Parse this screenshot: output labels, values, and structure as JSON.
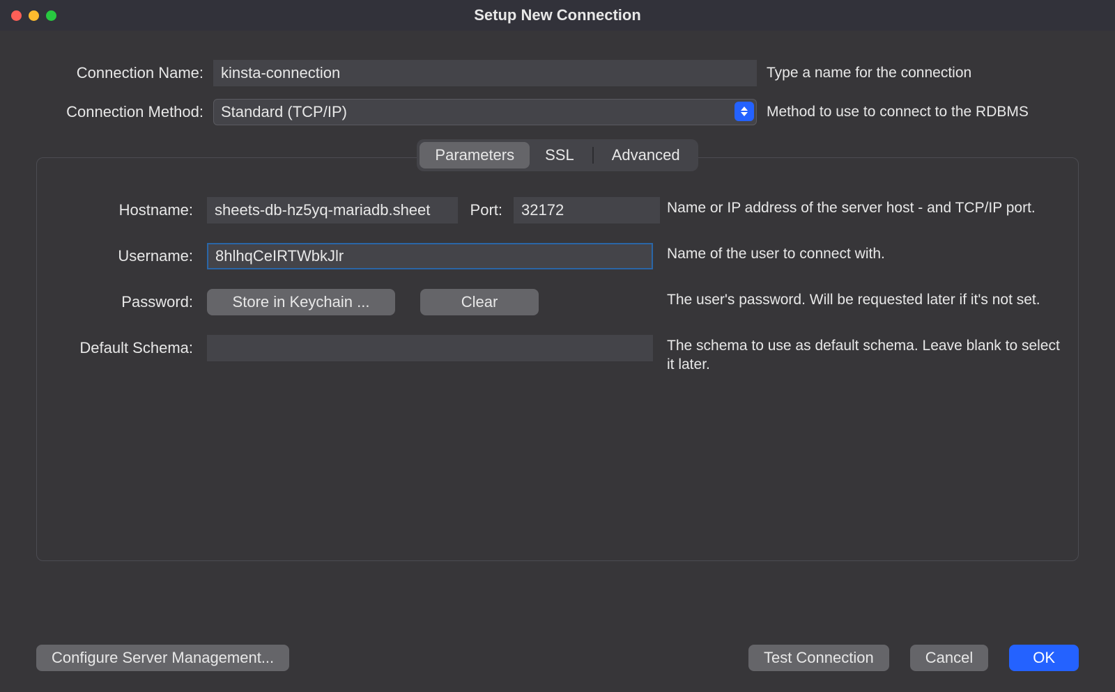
{
  "window": {
    "title": "Setup New Connection"
  },
  "top": {
    "name_label": "Connection Name:",
    "name_value": "kinsta-connection",
    "name_help": "Type a name for the connection",
    "method_label": "Connection Method:",
    "method_value": "Standard (TCP/IP)",
    "method_help": "Method to use to connect to the RDBMS"
  },
  "tabs": {
    "parameters": "Parameters",
    "ssl": "SSL",
    "advanced": "Advanced"
  },
  "params": {
    "hostname_label": "Hostname:",
    "hostname_value": "sheets-db-hz5yq-mariadb.sheet",
    "port_label": "Port:",
    "port_value": "32172",
    "hostport_help": "Name or IP address of the server host - and TCP/IP port.",
    "username_label": "Username:",
    "username_value": "8hlhqCeIRTWbkJlr",
    "username_help": "Name of the user to connect with.",
    "password_label": "Password:",
    "store_keychain": "Store in Keychain ...",
    "clear": "Clear",
    "password_help": "The user's password. Will be requested later if it's not set.",
    "schema_label": "Default Schema:",
    "schema_value": "",
    "schema_help": "The schema to use as default schema. Leave blank to select it later."
  },
  "footer": {
    "configure": "Configure Server Management...",
    "test": "Test Connection",
    "cancel": "Cancel",
    "ok": "OK"
  }
}
